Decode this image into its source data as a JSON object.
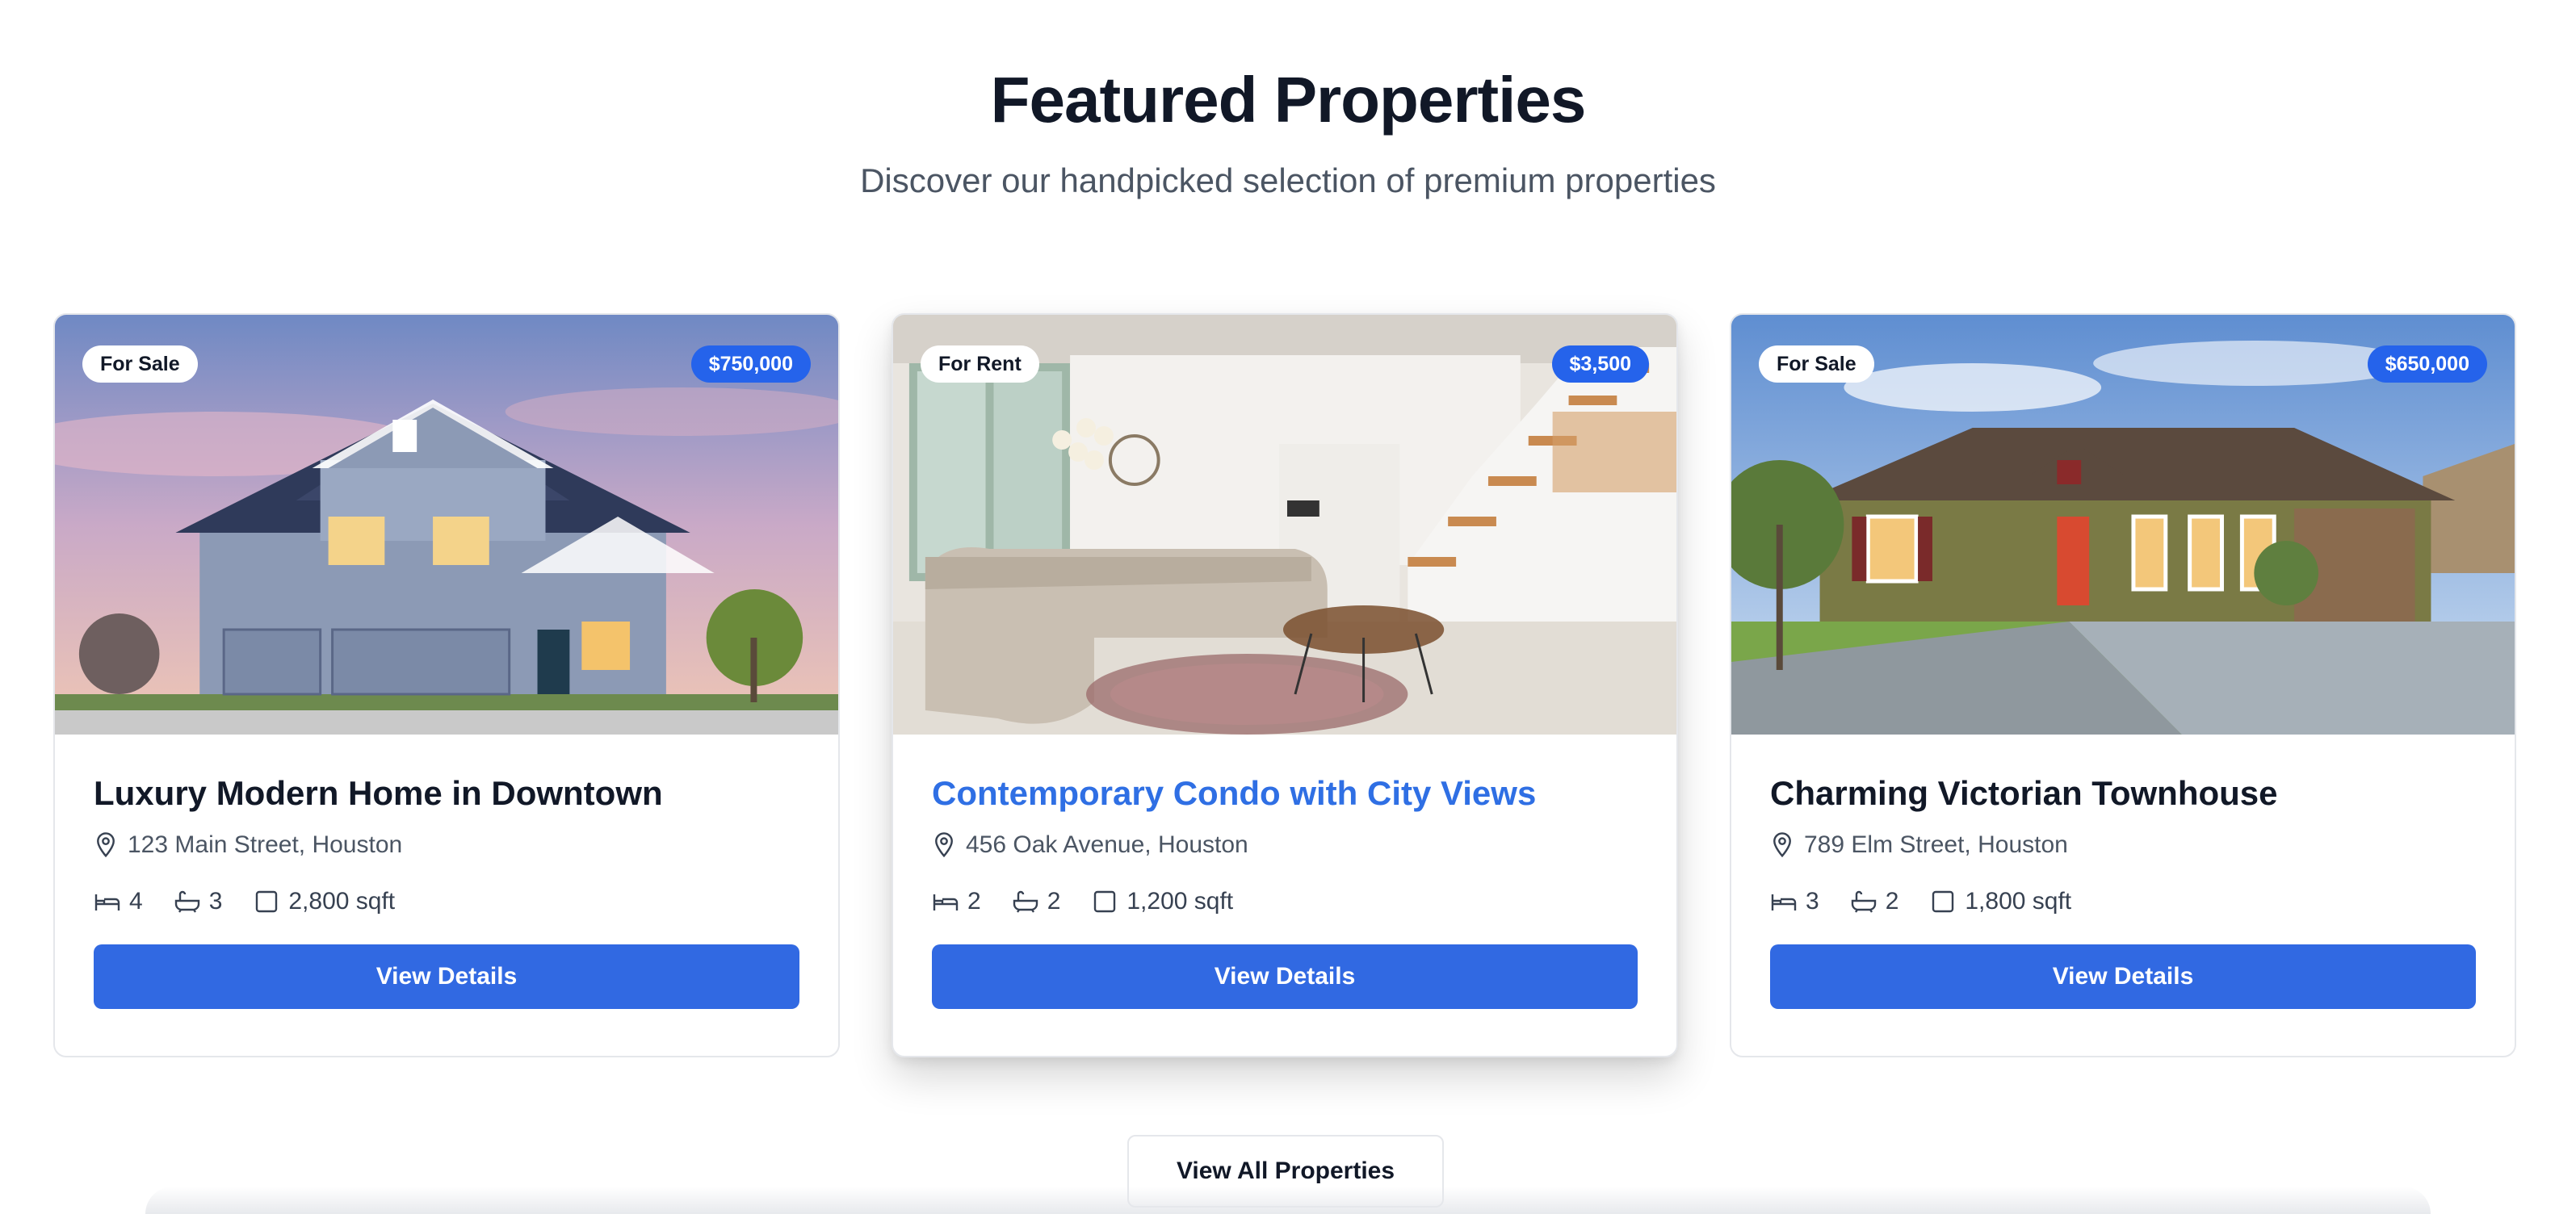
{
  "header": {
    "title": "Featured Properties",
    "subtitle": "Discover our handpicked selection of premium properties"
  },
  "properties": [
    {
      "type": "For Sale",
      "price": "$750,000",
      "title": "Luxury Modern Home in Downtown",
      "address": "123 Main Street, Houston",
      "beds": "4",
      "baths": "3",
      "area": "2,800 sqft",
      "button": "View Details",
      "image": "modern-house-photo"
    },
    {
      "type": "For Rent",
      "price": "$3,500",
      "title": "Contemporary Condo with City Views",
      "address": "456 Oak Avenue, Houston",
      "beds": "2",
      "baths": "2",
      "area": "1,200 sqft",
      "button": "View Details",
      "image": "condo-interior-photo"
    },
    {
      "type": "For Sale",
      "price": "$650,000",
      "title": "Charming Victorian Townhouse",
      "address": "789 Elm Street, Houston",
      "beds": "3",
      "baths": "2",
      "area": "1,800 sqft",
      "button": "View Details",
      "image": "townhouse-photo"
    }
  ],
  "footer": {
    "view_all_label": "View All Properties"
  },
  "colors": {
    "accent": "#2563eb",
    "hovered_title": "#2f6fe4",
    "heading": "#111827",
    "muted": "#4b5563"
  },
  "icons": {
    "address": "map-pin-icon",
    "beds": "bed-icon",
    "baths": "bath-icon",
    "area": "square-icon"
  }
}
